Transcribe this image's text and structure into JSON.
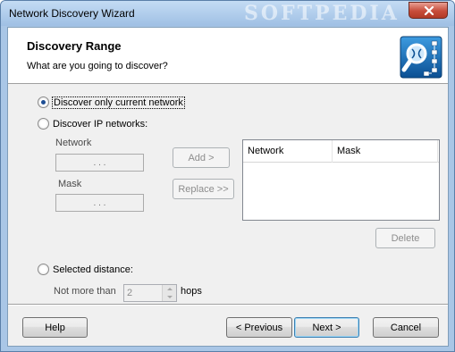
{
  "window": {
    "title": "Network Discovery Wizard",
    "watermark": "SOFTPEDIA"
  },
  "header": {
    "title": "Discovery Range",
    "subtitle": "What are you going to discover?",
    "icon": "network-discovery-icon"
  },
  "options": {
    "current_network": {
      "label": "Discover only current network",
      "checked": true
    },
    "ip_networks": {
      "label": "Discover IP networks:",
      "checked": false
    },
    "selected_distance": {
      "label": "Selected distance:",
      "checked": false
    }
  },
  "fields": {
    "network_label": "Network",
    "mask_label": "Mask",
    "network_value": ". . .",
    "mask_value": ". . .",
    "not_more_than_label": "Not more than",
    "hops_value": "2",
    "hops_label": "hops"
  },
  "buttons": {
    "add": "Add >",
    "replace": "Replace >>",
    "delete": "Delete",
    "help": "Help",
    "previous": "< Previous",
    "next": "Next >",
    "cancel": "Cancel"
  },
  "table": {
    "columns": [
      "Network",
      "Mask"
    ],
    "rows": []
  }
}
